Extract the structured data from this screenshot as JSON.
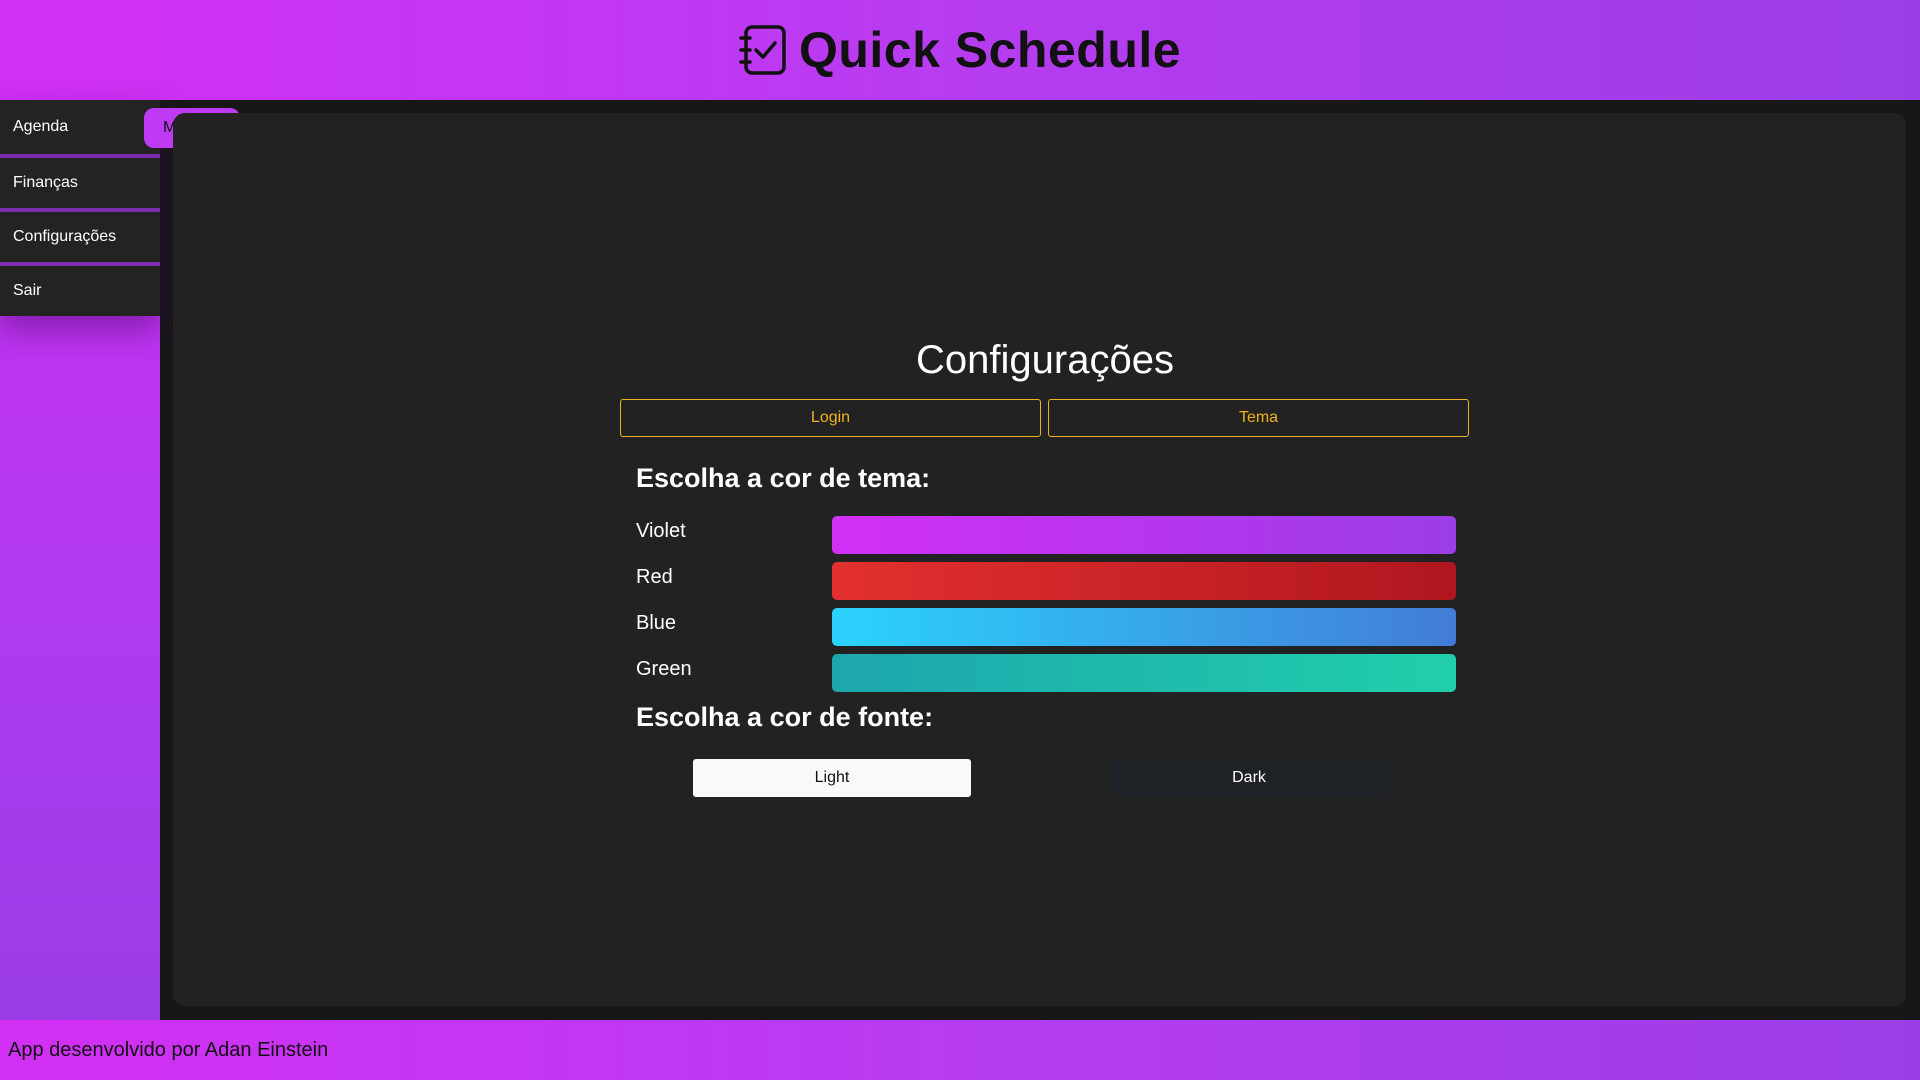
{
  "header": {
    "title": "Quick Schedule",
    "icon": "checklist-notebook-icon"
  },
  "sidebar": {
    "items": [
      {
        "label": "Agenda"
      },
      {
        "label": "Finanças"
      },
      {
        "label": "Configurações"
      },
      {
        "label": "Sair"
      }
    ]
  },
  "menu_button": {
    "label": "Menu",
    "icon": "hamburger-icon"
  },
  "settings": {
    "title": "Configurações",
    "tabs": [
      {
        "label": "Login"
      },
      {
        "label": "Tema"
      }
    ],
    "theme_heading": "Escolha a cor de tema:",
    "themes": [
      {
        "label": "Violet",
        "from": "#d22ff5",
        "to": "#9b3de6"
      },
      {
        "label": "Red",
        "from": "#e3302f",
        "to": "#b0161f"
      },
      {
        "label": "Blue",
        "from": "#2bd3fc",
        "to": "#437cd8"
      },
      {
        "label": "Green",
        "from": "#1ea6ad",
        "to": "#20cfac"
      }
    ],
    "font_heading": "Escolha a cor de fonte:",
    "font_options": {
      "light": "Light",
      "dark": "Dark"
    }
  },
  "footer": {
    "text": "App desenvolvido por Adan Einstein"
  },
  "colors": {
    "accent": "#c92ef4",
    "tab_outline": "#f2b21b",
    "panel_bg": "#222222"
  }
}
